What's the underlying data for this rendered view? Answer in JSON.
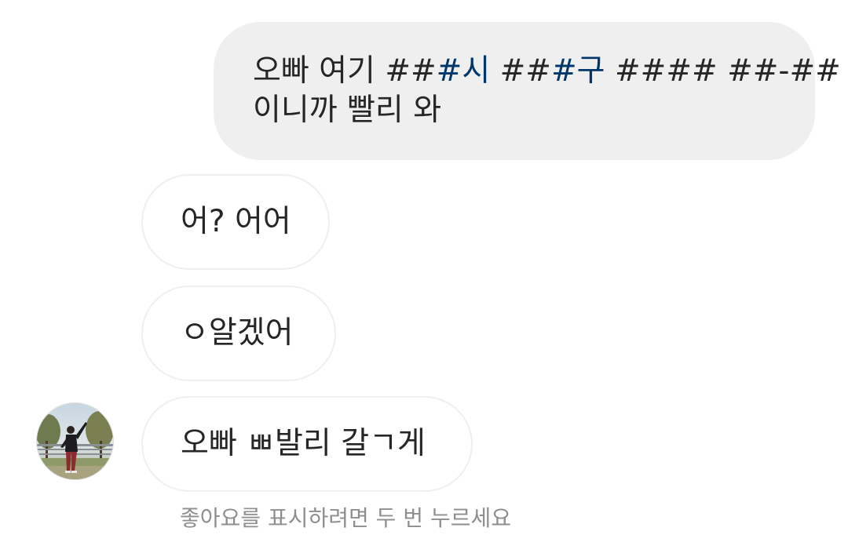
{
  "messages": {
    "sent": {
      "line1_prefix": "오빠 여기 ##",
      "line1_city": "#시",
      "line1_space": " ##",
      "line1_district": "#구",
      "line1_suffix": " #### ##-##",
      "line2": "이니까 빨리 와"
    },
    "received": [
      {
        "text": "어? 어어"
      },
      {
        "text": "ㅇ알겠어"
      },
      {
        "text": "오빠 ㅃ발리 갈ㄱ게"
      }
    ]
  },
  "hint": "좋아요를 표시하려면 두 번 누르세요",
  "colors": {
    "sent_bubble_bg": "#efefef",
    "received_bubble_border": "#efefef",
    "link_highlight": "#00376b",
    "hint_text": "#8e8e8e",
    "message_text": "#262626"
  },
  "icons": {
    "avatar": "profile-photo-icon"
  }
}
